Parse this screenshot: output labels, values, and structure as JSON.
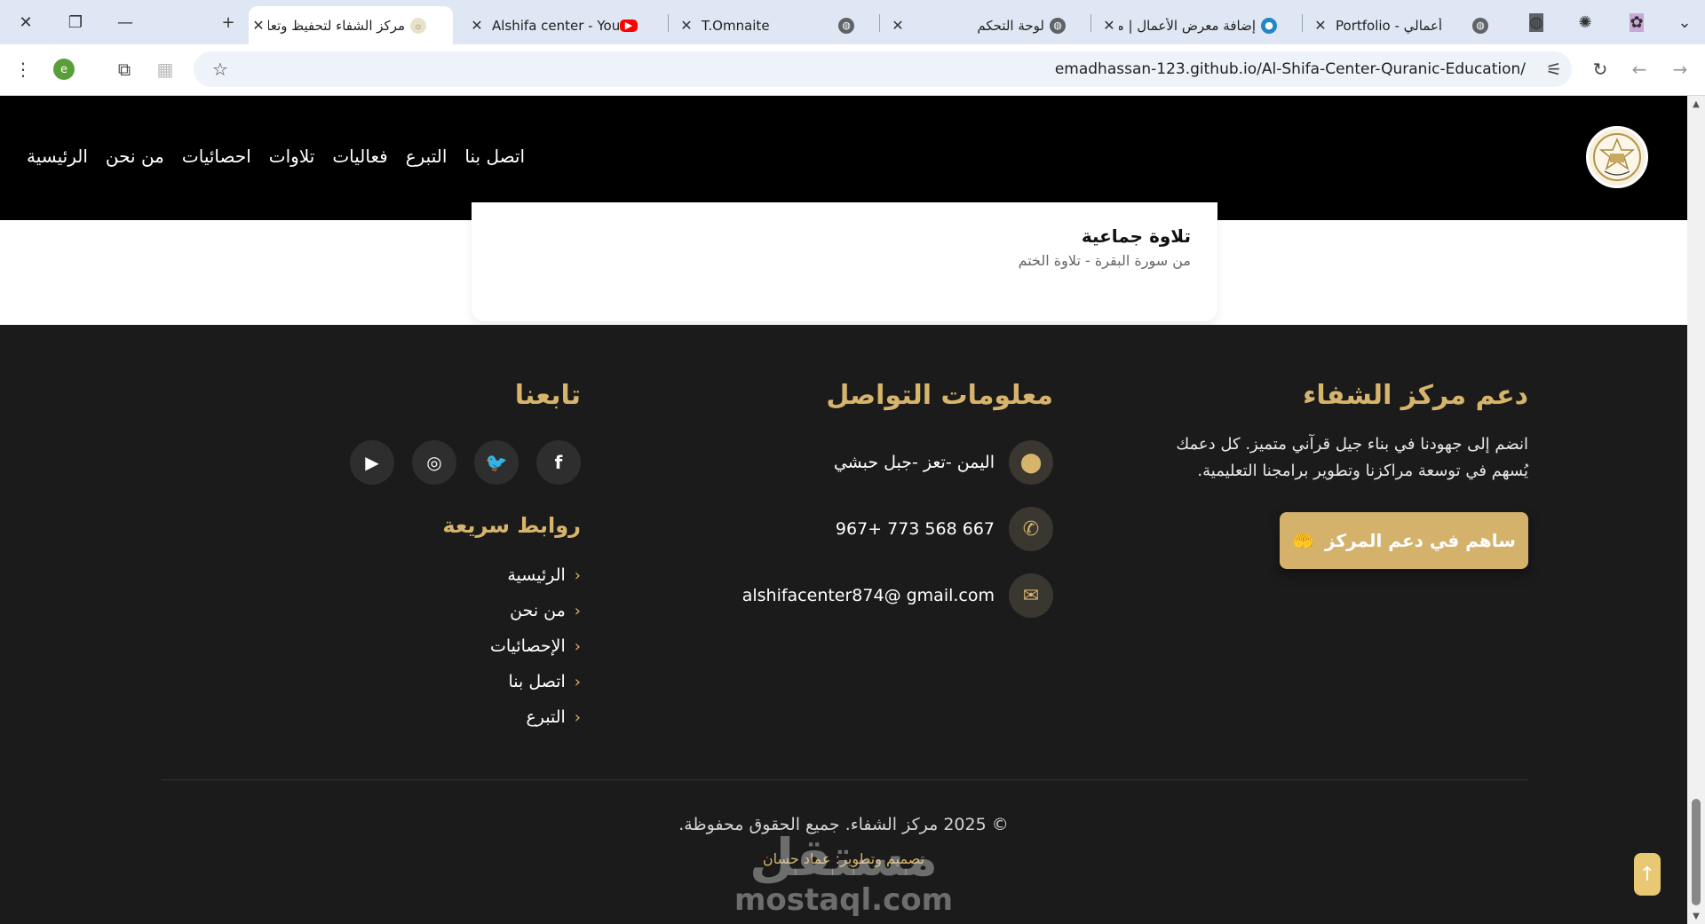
{
  "browser": {
    "tabs": [
      {
        "title": "مركز الشفاء لتحفيظ وتعليم",
        "active": true,
        "icon": "site-favicon-icon"
      },
      {
        "title": "Alshifa center - YouTube",
        "active": false,
        "icon": "youtube-icon"
      },
      {
        "title": "T.Omnaite",
        "active": false,
        "icon": "globe-icon"
      },
      {
        "title": "لوحة التحكم",
        "active": false,
        "icon": "globe-icon"
      },
      {
        "title": "إضافة معرض الأعمال | مستقل",
        "active": false,
        "icon": "mostaql-icon"
      },
      {
        "title": "Portfolio - أعمالي",
        "active": false,
        "icon": "globe-icon"
      }
    ],
    "url": "emadhassan-123.github.io/Al-Shifa-Center-Quranic-Education/",
    "profile_initial": "e"
  },
  "nav": {
    "items": [
      "الرئيسية",
      "من نحن",
      "احصائيات",
      "تلاوات",
      "فعاليات",
      "التبرع",
      "اتصل بنا"
    ]
  },
  "card": {
    "title": "تلاوة جماعية",
    "subtitle": "من سورة البقرة - تلاوة الختم"
  },
  "footer": {
    "support": {
      "heading": "دعم مركز الشفاء",
      "text": "انضم إلى جهودنا في بناء جيل قرآني متميز. كل دعمك يُسهم في توسعة مراكزنا وتطوير برامجنا التعليمية.",
      "button": "ساهم في دعم المركز"
    },
    "contact": {
      "heading": "معلومات التواصل",
      "address": "اليمن -تعز -جبل حبشي",
      "phone": "967+ 773 568 667",
      "email": "alshifacenter874@ gmail.com"
    },
    "follow": {
      "heading": "تابعنا",
      "socials": [
        "facebook-icon",
        "twitter-icon",
        "instagram-icon",
        "youtube-icon"
      ]
    },
    "quick_links": {
      "heading": "روابط سريعة",
      "items": [
        "الرئيسية",
        "من نحن",
        "الإحصائيات",
        "اتصل بنا",
        "التبرع"
      ]
    },
    "copyright": "© 2025 مركز الشفاء. جميع الحقوق محفوظة.",
    "credit": "تصميم وتطوير: عماد حسان",
    "watermark_ar": "مستقل",
    "watermark_en": "mostaql.com"
  },
  "colors": {
    "gold": "#d6b46c",
    "footer_bg": "#1c1b1b",
    "header_bg": "#000000"
  }
}
